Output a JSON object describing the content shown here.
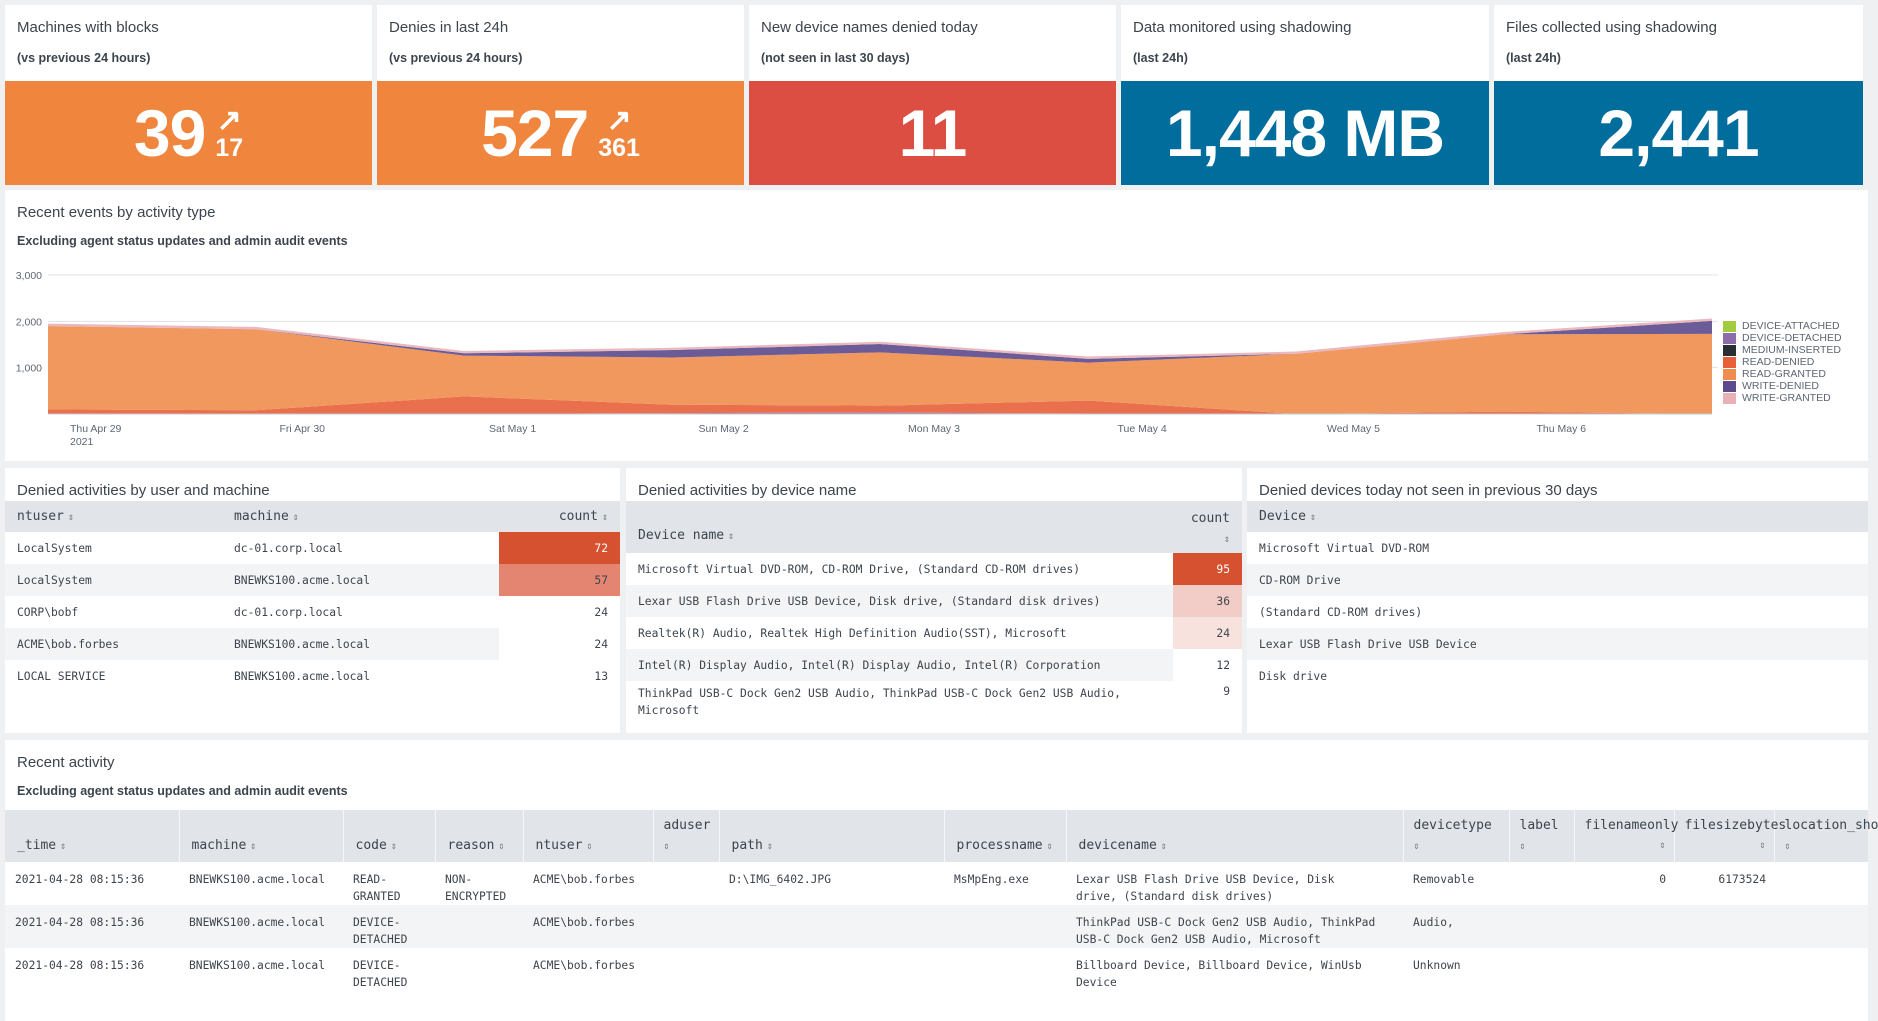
{
  "single_values": [
    {
      "title": "Machines with blocks",
      "subtitle": "(vs previous 24 hours)",
      "value": "39",
      "trend": "17",
      "trend_arrow": "↗",
      "color": "#f0863e"
    },
    {
      "title": "Denies in last 24h",
      "subtitle": "(vs previous 24 hours)",
      "value": "527",
      "trend": "361",
      "trend_arrow": "↗",
      "color": "#f0863e"
    },
    {
      "title": "New device names denied today",
      "subtitle": "(not seen in last 30 days)",
      "value": "11",
      "color": "#dc4e41"
    },
    {
      "title": "Data monitored using shadowing",
      "subtitle": "(last 24h)",
      "value": "1,448 MB",
      "color": "#006d9c"
    },
    {
      "title": "Files collected using shadowing",
      "subtitle": "(last 24h)",
      "value": "2,441",
      "color": "#006d9c"
    }
  ],
  "events_panel": {
    "title": "Recent events by activity type",
    "subtitle": "Excluding agent status updates and admin audit events"
  },
  "chart_data": {
    "type": "area",
    "stacked": true,
    "x": [
      "Thu Apr 29 2021",
      "Fri Apr 30",
      "Sat May 1",
      "Sun May 2",
      "Mon May 3",
      "Tue May 4",
      "Wed May 5",
      "Thu May 6"
    ],
    "x_tick_labels": [
      [
        "Thu Apr 29",
        "2021"
      ],
      [
        "Fri Apr 30"
      ],
      [
        "Sat May 1"
      ],
      [
        "Sun May 2"
      ],
      [
        "Mon May 3"
      ],
      [
        "Tue May 4"
      ],
      [
        "Wed May 5"
      ],
      [
        "Thu May 6"
      ]
    ],
    "x_points": [
      0,
      1,
      2,
      3,
      4,
      5,
      6,
      7,
      8
    ],
    "y_ticks": [
      "3,000",
      "2,000",
      "1,000"
    ],
    "ylim": [
      0,
      3000
    ],
    "legend_position": "right",
    "grid": true,
    "series": [
      {
        "name": "DEVICE-ATTACHED",
        "color": "#a2cc3e",
        "values": [
          0,
          0,
          0,
          0,
          0,
          0,
          0,
          0,
          0
        ]
      },
      {
        "name": "DEVICE-DETACHED",
        "color": "#8d6ca8",
        "values": [
          0,
          0,
          0,
          20,
          30,
          10,
          0,
          0,
          0
        ]
      },
      {
        "name": "MEDIUM-INSERTED",
        "color": "#292e35",
        "values": [
          0,
          0,
          0,
          0,
          0,
          0,
          0,
          0,
          0
        ]
      },
      {
        "name": "READ-DENIED",
        "color": "#e8603a",
        "values": [
          100,
          80,
          380,
          180,
          150,
          280,
          0,
          50,
          0
        ]
      },
      {
        "name": "READ-GRANTED",
        "color": "#ef8d4e",
        "values": [
          1800,
          1750,
          880,
          1020,
          1150,
          820,
          1300,
          1670,
          1730
        ]
      },
      {
        "name": "WRITE-DENIED",
        "color": "#5b4a8c",
        "values": [
          0,
          0,
          50,
          160,
          180,
          80,
          0,
          0,
          280
        ]
      },
      {
        "name": "WRITE-GRANTED",
        "color": "#e8b1b8",
        "values": [
          50,
          50,
          50,
          50,
          50,
          50,
          50,
          50,
          50
        ]
      }
    ]
  },
  "denied_user_machine": {
    "title": "Denied activities by user and machine",
    "headers": [
      "ntuser",
      "machine",
      "count"
    ],
    "rows": [
      {
        "ntuser": "LocalSystem",
        "machine": "dc-01.corp.local",
        "count": "72",
        "heat": "#d6512f",
        "fg": "#ffffff"
      },
      {
        "ntuser": "LocalSystem",
        "machine": "BNEWKS100.acme.local",
        "count": "57",
        "heat": "#e48571",
        "fg": "#3c444d"
      },
      {
        "ntuser": "CORP\\bobf",
        "machine": "dc-01.corp.local",
        "count": "24",
        "heat": "",
        "fg": "#3c444d"
      },
      {
        "ntuser": "ACME\\bob.forbes",
        "machine": "BNEWKS100.acme.local",
        "count": "24",
        "heat": "",
        "fg": "#3c444d"
      },
      {
        "ntuser": "LOCAL SERVICE",
        "machine": "BNEWKS100.acme.local",
        "count": "13",
        "heat": "",
        "fg": "#3c444d"
      }
    ]
  },
  "denied_device": {
    "title": "Denied activities by device name",
    "headers": [
      "Device name",
      "count"
    ],
    "rows": [
      {
        "name": "Microsoft Virtual DVD-ROM, CD-ROM Drive, (Standard CD-ROM drives)",
        "count": "95",
        "heat": "#d6512f",
        "fg": "#ffffff"
      },
      {
        "name": "Lexar USB Flash Drive USB Device, Disk drive, (Standard disk drives)",
        "count": "36",
        "heat": "#f2ccc6",
        "fg": "#3c444d"
      },
      {
        "name": "Realtek(R) Audio, Realtek High Definition Audio(SST), Microsoft",
        "count": "24",
        "heat": "#f7e2de",
        "fg": "#3c444d"
      },
      {
        "name": "Intel(R) Display Audio, Intel(R) Display Audio, Intel(R) Corporation",
        "count": "12",
        "heat": "",
        "fg": "#3c444d"
      },
      {
        "name": "ThinkPad USB-C Dock Gen2 USB Audio, ThinkPad USB-C Dock Gen2 USB Audio,",
        "name2": "Microsoft",
        "count": "9",
        "heat": "",
        "fg": "#3c444d"
      }
    ]
  },
  "denied_new": {
    "title": "Denied devices today not seen in previous 30 days",
    "headers": [
      "Device"
    ],
    "rows": [
      "Microsoft Virtual DVD-ROM",
      "CD-ROM Drive",
      "(Standard CD-ROM drives)",
      "Lexar USB Flash Drive USB Device",
      "Disk drive"
    ]
  },
  "recent_activity": {
    "title": "Recent activity",
    "subtitle": "Excluding agent status updates and admin audit events",
    "headers": [
      "_time",
      "machine",
      "code",
      "reason",
      "ntuser",
      "aduser",
      "path",
      "processname",
      "devicename",
      "devicetype",
      "label",
      "filenameonly",
      "filesizebytes",
      "location_short"
    ],
    "rows": [
      {
        "_time": "2021-04-28 08:15:36",
        "machine": "BNEWKS100.acme.local",
        "code": "READ-",
        "code2": "GRANTED",
        "reason": "NON-",
        "reason2": "ENCRYPTED",
        "ntuser": "ACME\\bob.forbes",
        "aduser": "",
        "path": "D:\\IMG_6402.JPG",
        "processname": "MsMpEng.exe",
        "devicename": "Lexar USB Flash Drive USB Device, Disk",
        "devicename2": "drive, (Standard disk drives)",
        "devicetype": "Removable",
        "label": "",
        "filenameonly": "0",
        "filesizebytes": "6173524",
        "location_short": ""
      },
      {
        "_time": "2021-04-28 08:15:36",
        "machine": "BNEWKS100.acme.local",
        "code": "DEVICE-",
        "code2": "DETACHED",
        "reason": "",
        "reason2": "",
        "ntuser": "ACME\\bob.forbes",
        "aduser": "",
        "path": "",
        "processname": "",
        "devicename": "ThinkPad USB-C Dock Gen2 USB Audio, ThinkPad",
        "devicename2": "USB-C Dock Gen2 USB Audio, Microsoft",
        "devicetype": "Audio,",
        "label": "",
        "filenameonly": "",
        "filesizebytes": "",
        "location_short": ""
      },
      {
        "_time": "2021-04-28 08:15:36",
        "machine": "BNEWKS100.acme.local",
        "code": "DEVICE-",
        "code2": "DETACHED",
        "reason": "",
        "reason2": "",
        "ntuser": "ACME\\bob.forbes",
        "aduser": "",
        "path": "",
        "processname": "",
        "devicename": "Billboard Device, Billboard Device, WinUsb",
        "devicename2": "Device",
        "devicetype": "Unknown",
        "label": "",
        "filenameonly": "",
        "filesizebytes": "",
        "location_short": ""
      }
    ]
  }
}
